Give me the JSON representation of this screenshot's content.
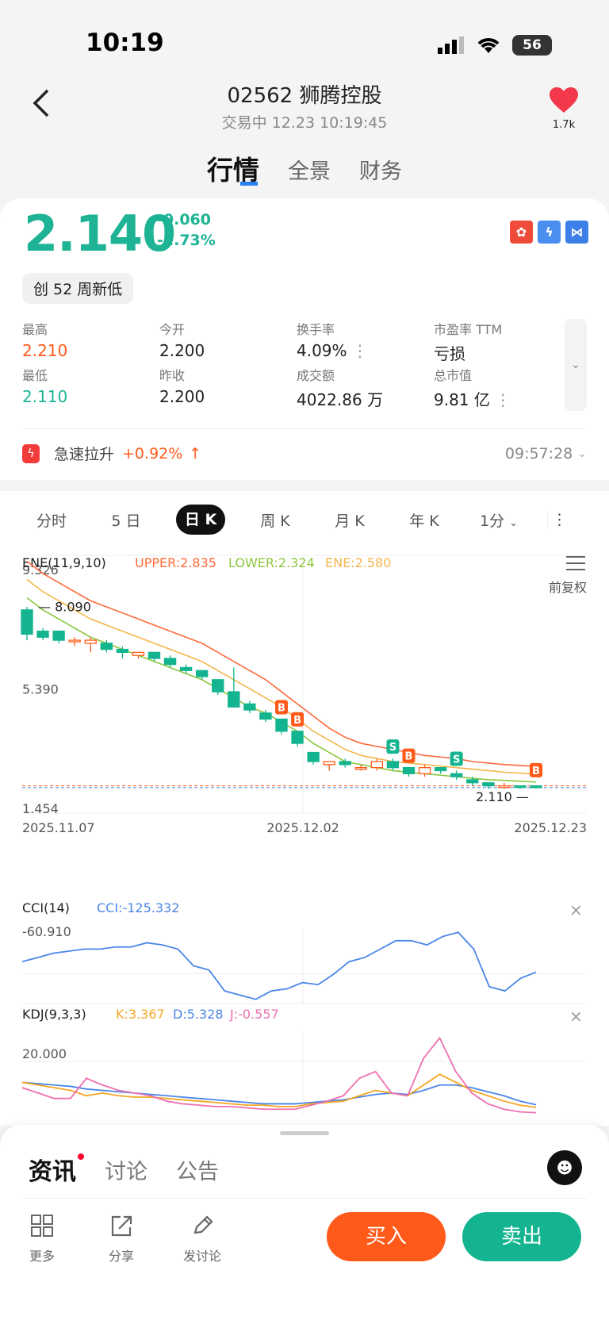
{
  "status": {
    "time": "10:19",
    "battery": "56"
  },
  "header": {
    "title": "02562 狮腾控股",
    "subtitle": "交易中 12.23 10:19:45",
    "fav_count": "1.7k"
  },
  "top_tabs": [
    "行情",
    "全景",
    "财务"
  ],
  "quote": {
    "price": "2.140",
    "change": "-0.060",
    "change_pct": "-2.73%",
    "badge": "创 52 周新低",
    "market_icons": [
      "hk-flag-icon",
      "lightning-icon",
      "connect-icon"
    ],
    "stats": [
      {
        "label": "最高",
        "value": "2.210",
        "color": "#ff5a1a"
      },
      {
        "label": "今开",
        "value": "2.200",
        "color": "#222"
      },
      {
        "label": "换手率",
        "value": "4.09%",
        "color": "#222"
      },
      {
        "label": "市盈率 TTM",
        "value": "亏损",
        "color": "#222"
      },
      {
        "label": "最低",
        "value": "2.110",
        "color": "#1db394"
      },
      {
        "label": "昨收",
        "value": "2.200",
        "color": "#222"
      },
      {
        "label": "成交额",
        "value": "4022.86 万",
        "color": "#222"
      },
      {
        "label": "总市值",
        "value": "9.81 亿",
        "color": "#222"
      }
    ],
    "alert": {
      "text": "急速拉升",
      "pct": "+0.92%",
      "time": "09:57:28"
    }
  },
  "kline_tabs": [
    "分时",
    "5 日",
    "日 K",
    "周 K",
    "月 K",
    "年 K",
    "1分"
  ],
  "indicators": {
    "ene": {
      "name": "ENE(11,9,10)",
      "upper": "UPPER:2.835",
      "lower": "LOWER:2.324",
      "ene": "ENE:2.580",
      "adjust": "前复权"
    },
    "cci": {
      "name": "CCI(14)",
      "value": "CCI:-125.332",
      "level": "-60.910"
    },
    "kdj": {
      "name": "KDJ(9,3,3)",
      "k": "K:3.367",
      "d": "D:5.328",
      "j": "J:-0.557",
      "level": "20.000"
    }
  },
  "chart_data": {
    "type": "candlestick",
    "y_ticks": [
      "9.326",
      "5.390",
      "1.454"
    ],
    "x_ticks": [
      "2025.11.07",
      "2025.12.02",
      "2025.12.23"
    ],
    "high_label": "8.090",
    "low_label": "2.110",
    "colors": {
      "down": "#13b48f",
      "up": "#ff5a1a",
      "upper": "#ff6a3a",
      "lower": "#8cc63f",
      "ene": "#f5b54a",
      "cci": "#4a86e8",
      "k": "#f5a623",
      "d": "#4a86e8",
      "j": "#ee6fb0"
    },
    "candles": [
      [
        8.0,
        7.2,
        8.1,
        7.0
      ],
      [
        7.3,
        7.1,
        7.4,
        7.0
      ],
      [
        7.3,
        7.0,
        7.3,
        6.9
      ],
      [
        7.0,
        7.0,
        7.1,
        6.8
      ],
      [
        6.9,
        7.0,
        7.1,
        6.6
      ],
      [
        6.9,
        6.7,
        7.0,
        6.6
      ],
      [
        6.7,
        6.6,
        6.8,
        6.4
      ],
      [
        6.5,
        6.6,
        6.6,
        6.4
      ],
      [
        6.6,
        6.4,
        6.6,
        6.3
      ],
      [
        6.4,
        6.2,
        6.5,
        6.1
      ],
      [
        6.1,
        6.0,
        6.2,
        5.9
      ],
      [
        6.0,
        5.8,
        6.0,
        5.7
      ],
      [
        5.7,
        5.3,
        5.7,
        5.2
      ],
      [
        5.3,
        4.8,
        6.1,
        4.8
      ],
      [
        4.9,
        4.7,
        5.0,
        4.6
      ],
      [
        4.6,
        4.4,
        4.7,
        4.3
      ],
      [
        4.4,
        4.0,
        4.4,
        3.9
      ],
      [
        4.0,
        3.6,
        4.0,
        3.5
      ],
      [
        3.3,
        3.0,
        3.3,
        2.9
      ],
      [
        2.9,
        3.0,
        3.0,
        2.7
      ],
      [
        3.0,
        2.9,
        3.1,
        2.8
      ],
      [
        2.8,
        2.8,
        2.9,
        2.7
      ],
      [
        2.8,
        3.0,
        3.1,
        2.7
      ],
      [
        3.0,
        2.8,
        3.1,
        2.7
      ],
      [
        2.8,
        2.6,
        2.8,
        2.5
      ],
      [
        2.6,
        2.8,
        2.9,
        2.5
      ],
      [
        2.8,
        2.7,
        2.8,
        2.6
      ],
      [
        2.6,
        2.5,
        2.7,
        2.4
      ],
      [
        2.4,
        2.3,
        2.5,
        2.2
      ],
      [
        2.3,
        2.2,
        2.3,
        2.1
      ],
      [
        2.2,
        2.2,
        2.3,
        2.1
      ],
      [
        2.2,
        2.15,
        2.2,
        2.1
      ],
      [
        2.2,
        2.14,
        2.21,
        2.11
      ]
    ],
    "upper": [
      9.6,
      9.2,
      8.9,
      8.6,
      8.3,
      8.1,
      7.9,
      7.7,
      7.5,
      7.3,
      7.1,
      6.9,
      6.6,
      6.3,
      6.0,
      5.7,
      5.3,
      4.9,
      4.5,
      4.1,
      3.8,
      3.6,
      3.5,
      3.4,
      3.3,
      3.2,
      3.15,
      3.1,
      3.0,
      2.95,
      2.9,
      2.87,
      2.835
    ],
    "ene": [
      9.0,
      8.6,
      8.3,
      8.0,
      7.7,
      7.5,
      7.3,
      7.1,
      6.9,
      6.7,
      6.5,
      6.3,
      6.0,
      5.7,
      5.4,
      5.1,
      4.8,
      4.4,
      4.0,
      3.7,
      3.4,
      3.2,
      3.1,
      3.0,
      2.95,
      2.9,
      2.85,
      2.8,
      2.75,
      2.7,
      2.65,
      2.62,
      2.58
    ],
    "lower": [
      8.4,
      8.0,
      7.7,
      7.4,
      7.1,
      6.9,
      6.7,
      6.5,
      6.3,
      6.1,
      5.9,
      5.7,
      5.4,
      5.1,
      4.8,
      4.6,
      4.3,
      4.0,
      3.6,
      3.3,
      3.0,
      2.9,
      2.8,
      2.7,
      2.65,
      2.6,
      2.55,
      2.5,
      2.45,
      2.4,
      2.38,
      2.35,
      2.324
    ],
    "signals": [
      {
        "i": 16,
        "t": "B"
      },
      {
        "i": 17,
        "t": "B"
      },
      {
        "i": 23,
        "t": "S"
      },
      {
        "i": 24,
        "t": "B"
      },
      {
        "i": 27,
        "t": "S"
      },
      {
        "i": 32,
        "t": "B"
      }
    ],
    "cci": [
      -70,
      -60,
      -50,
      -45,
      -40,
      -40,
      -35,
      -35,
      -25,
      -30,
      -40,
      -80,
      -90,
      -140,
      -150,
      -160,
      -140,
      -135,
      -120,
      -125,
      -100,
      -70,
      -60,
      -40,
      -20,
      -20,
      -30,
      -10,
      0,
      -40,
      -130,
      -140,
      -110,
      -95
    ],
    "k": [
      22,
      20,
      18,
      16,
      12,
      14,
      12,
      11,
      11,
      10,
      9,
      8,
      7,
      6,
      5,
      5,
      4,
      4,
      6,
      7,
      8,
      12,
      16,
      14,
      12,
      20,
      28,
      22,
      16,
      12,
      8,
      5,
      3.4
    ],
    "d": [
      22,
      21,
      20,
      19,
      17,
      16,
      15,
      14,
      13,
      12,
      11,
      10,
      9,
      8,
      7,
      6,
      6,
      6,
      7,
      8,
      9,
      11,
      13,
      14,
      13,
      16,
      20,
      20,
      18,
      15,
      12,
      8,
      5.3
    ],
    "j": [
      18,
      14,
      10,
      10,
      25,
      20,
      16,
      14,
      12,
      8,
      6,
      5,
      4,
      4,
      3,
      2,
      2,
      2,
      5,
      8,
      12,
      25,
      30,
      14,
      12,
      40,
      55,
      30,
      14,
      6,
      2,
      0,
      -0.6
    ]
  },
  "bottom": {
    "tabs": [
      "资讯",
      "讨论",
      "公告"
    ],
    "actions": [
      {
        "icon": "grid-icon",
        "label": "更多"
      },
      {
        "icon": "share-icon",
        "label": "分享"
      },
      {
        "icon": "pen-icon",
        "label": "发讨论"
      }
    ],
    "buy": "买入",
    "sell": "卖出"
  }
}
